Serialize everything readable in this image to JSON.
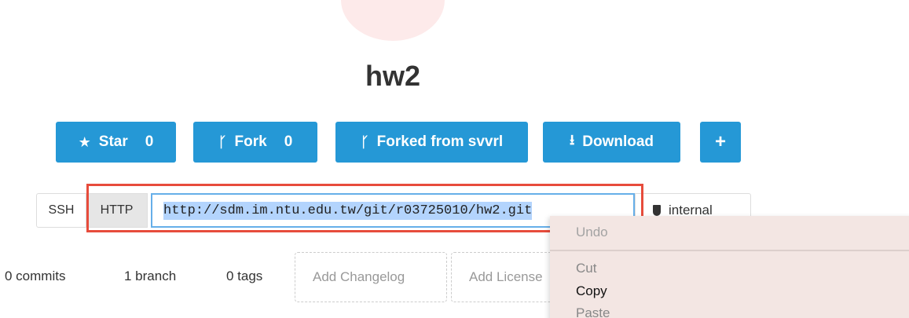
{
  "repo": {
    "name": "hw2"
  },
  "actions": {
    "star_label": "Star",
    "star_count": "0",
    "fork_label": "Fork",
    "fork_count": "0",
    "forked_label": "Forked from svvrl",
    "download_label": "Download",
    "plus_label": "+"
  },
  "clone": {
    "ssh_label": "SSH",
    "http_label": "HTTP",
    "url": "http://sdm.im.ntu.edu.tw/git/r03725010/hw2.git",
    "visibility_label": "internal"
  },
  "stats": {
    "commits": "0 commits",
    "branch": "1 branch",
    "tags": "0 tags"
  },
  "quick_actions": {
    "changelog": "Add Changelog",
    "license": "Add License"
  },
  "context_menu": {
    "undo": "Undo",
    "cut": "Cut",
    "copy": "Copy",
    "paste": "Paste"
  },
  "colors": {
    "accent": "#2598d6",
    "highlight": "#e74c3c",
    "selection": "#b3d4fd"
  },
  "icons": {
    "star": "star-icon",
    "fork": "fork-icon",
    "download": "download-icon",
    "visibility": "shield-icon"
  }
}
